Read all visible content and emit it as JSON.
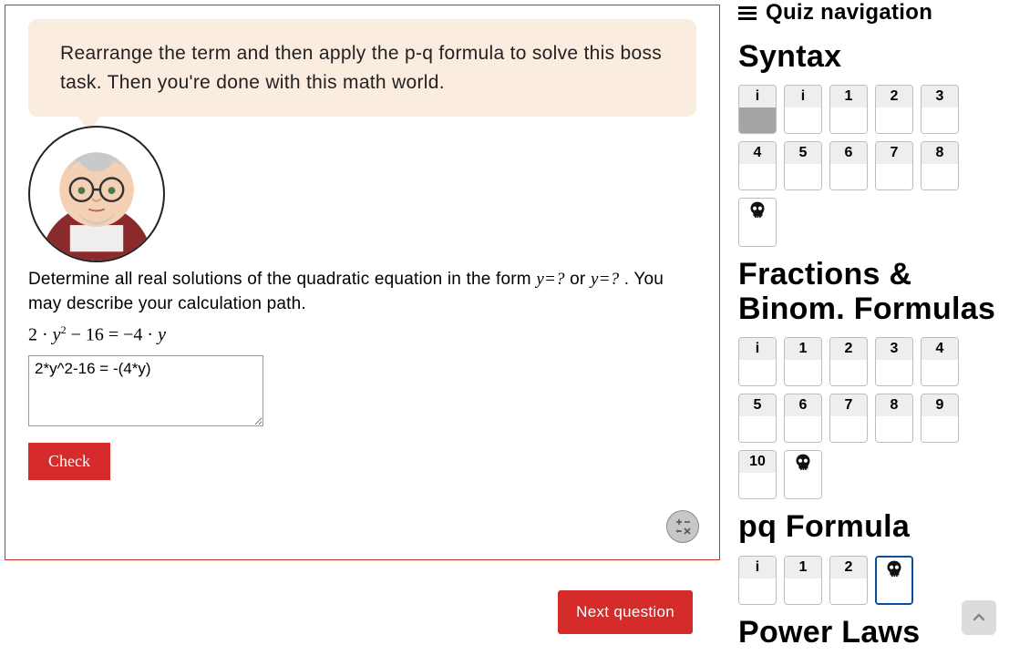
{
  "speech_text": "Rearrange the term and then apply the p-q formula to solve this boss task. Then you're done with this math world.",
  "question": {
    "text_before": "Determine all real solutions of the quadratic equation in the form ",
    "inline1": "y=?",
    "text_mid": " or ",
    "inline2": "y=?",
    "text_after": " . You may describe your calculation path."
  },
  "equation_parts": {
    "full": "2 · y² − 16 = −4 · y"
  },
  "answer_value": "2*y^2-16 = -(4*y)",
  "check_label": "Check",
  "next_label": "Next question",
  "nav": {
    "title": "Quiz navigation",
    "sections": [
      {
        "title": "Syntax",
        "tiles": [
          {
            "label": "i",
            "answered": true
          },
          {
            "label": "i"
          },
          {
            "label": "1"
          },
          {
            "label": "2"
          },
          {
            "label": "3"
          },
          {
            "label": "4"
          },
          {
            "label": "5"
          },
          {
            "label": "6"
          },
          {
            "label": "7"
          },
          {
            "label": "8"
          },
          {
            "skull": true
          }
        ]
      },
      {
        "title": "Fractions & Binom. Formulas",
        "tiles": [
          {
            "label": "i"
          },
          {
            "label": "1"
          },
          {
            "label": "2"
          },
          {
            "label": "3"
          },
          {
            "label": "4"
          },
          {
            "label": "5"
          },
          {
            "label": "6"
          },
          {
            "label": "7"
          },
          {
            "label": "8"
          },
          {
            "label": "9"
          },
          {
            "label": "10"
          },
          {
            "skull": true
          }
        ]
      },
      {
        "title": "pq Formula",
        "tiles": [
          {
            "label": "i"
          },
          {
            "label": "1"
          },
          {
            "label": "2"
          },
          {
            "skull": true,
            "current": true
          }
        ]
      },
      {
        "title": "Power Laws",
        "tiles": []
      }
    ]
  }
}
